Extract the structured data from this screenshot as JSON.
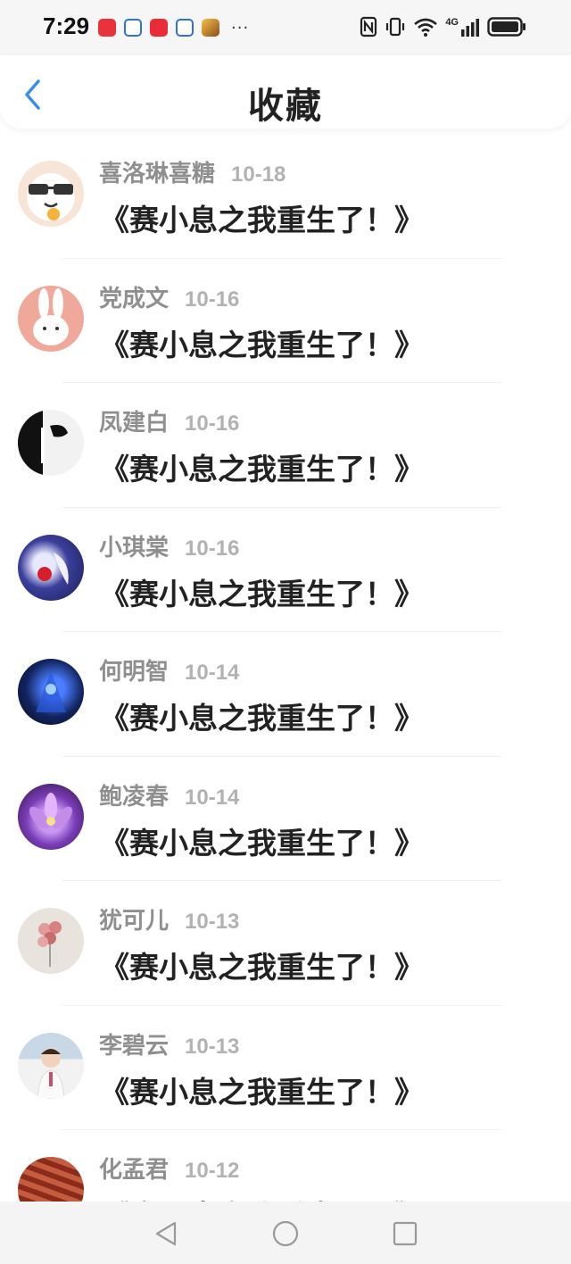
{
  "status_bar": {
    "time": "7:29",
    "more": "···",
    "network": "4G"
  },
  "header": {
    "title": "收藏"
  },
  "colors": {
    "accent": "#3a8ee6",
    "name_text": "#8f8f8f",
    "date_text": "#b2b2b2",
    "title_text": "#222222"
  },
  "items": [
    {
      "name": "喜洛琳喜糖",
      "date": "10-18",
      "title": "《赛小息之我重生了！》",
      "avatar_icon": "cartoon-sunglasses-avatar"
    },
    {
      "name": "党成文",
      "date": "10-16",
      "title": "《赛小息之我重生了！》",
      "avatar_icon": "rabbit-avatar"
    },
    {
      "name": "凤建白",
      "date": "10-16",
      "title": "《赛小息之我重生了！》",
      "avatar_icon": "dark-figure-avatar"
    },
    {
      "name": "小琪棠",
      "date": "10-16",
      "title": "《赛小息之我重生了！》",
      "avatar_icon": "anime-character-avatar"
    },
    {
      "name": "何明智",
      "date": "10-14",
      "title": "《赛小息之我重生了！》",
      "avatar_icon": "game-hero-avatar"
    },
    {
      "name": "鲍凌春",
      "date": "10-14",
      "title": "《赛小息之我重生了！》",
      "avatar_icon": "purple-flower-avatar"
    },
    {
      "name": "犹可儿",
      "date": "10-13",
      "title": "《赛小息之我重生了！》",
      "avatar_icon": "balloons-avatar"
    },
    {
      "name": "李碧云",
      "date": "10-13",
      "title": "《赛小息之我重生了！》",
      "avatar_icon": "child-photo-avatar"
    },
    {
      "name": "化孟君",
      "date": "10-12",
      "title": "《赛小息之我重生了！》",
      "avatar_icon": "red-landscape-avatar"
    }
  ]
}
